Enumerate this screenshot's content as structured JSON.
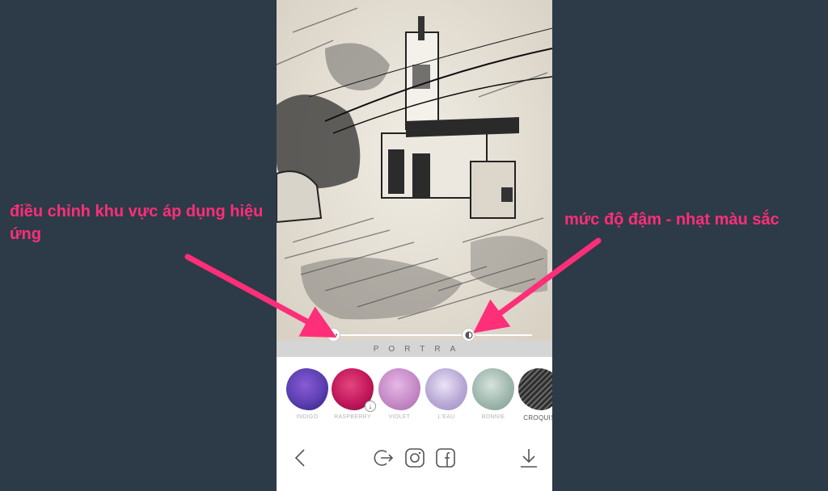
{
  "annotations": {
    "left": "điều chỉnh khu vực áp dụng hiệu ứng",
    "right": "mức độ đậm - nhạt màu sắc"
  },
  "effect": {
    "name": "PORTRA"
  },
  "filters": [
    {
      "label": "INDIGO",
      "color": "#5b3fb0",
      "downloadable": false
    },
    {
      "label": "RASPBERRY",
      "color": "#c2185b",
      "downloadable": true
    },
    {
      "label": "VIOLET",
      "color": "#c58bc7",
      "downloadable": false
    },
    {
      "label": "L'EAU",
      "color": "#b9a9d6",
      "downloadable": false
    },
    {
      "label": "BONNIE",
      "color": "#9fb8ad",
      "downloadable": false
    },
    {
      "label": "CROQUIS",
      "color": "#3a3a3a",
      "downloadable": false
    }
  ],
  "toolbar": {
    "back_icon": "chevron-left-icon",
    "share_icon": "share-exit-icon",
    "instagram_icon": "instagram-icon",
    "facebook_icon": "facebook-icon",
    "download_icon": "download-icon"
  },
  "colors": {
    "background": "#2d3a48",
    "annotation": "#ff2e78"
  }
}
